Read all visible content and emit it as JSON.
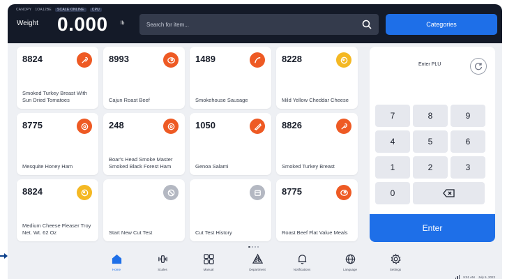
{
  "header": {
    "tiny_tags": [
      "CANOPY",
      "1OA12BE",
      "SCALE ONLINE",
      "CPU"
    ],
    "weight_label": "Weight",
    "weight_value": "0.000",
    "weight_unit": "lb",
    "search_placeholder": "Search for item...",
    "categories_label": "Categories"
  },
  "products": [
    {
      "plu": "8824",
      "name": "Smoked Turkey Breast With Sun Dried Tomatoes",
      "icon": "turkey-icon",
      "color": "#ee5a24"
    },
    {
      "plu": "8993",
      "name": "Cajun Roast Beef",
      "icon": "beef-icon",
      "color": "#ee5a24"
    },
    {
      "plu": "1489",
      "name": "Smokehouse Sausage",
      "icon": "sausage-icon",
      "color": "#ee5a24"
    },
    {
      "plu": "8228",
      "name": "Mild Yellow Cheddar Cheese",
      "icon": "cheese-icon",
      "color": "#f4b823"
    },
    {
      "plu": "8775",
      "name": "Mesquite Honey Ham",
      "icon": "ham-icon",
      "color": "#ee5a24"
    },
    {
      "plu": "248",
      "name": "Boar's Head Smoke Master Smoked Black Forest Ham",
      "icon": "ham-icon",
      "color": "#ee5a24"
    },
    {
      "plu": "1050",
      "name": "Genoa Salami",
      "icon": "salami-icon",
      "color": "#ee5a24"
    },
    {
      "plu": "8826",
      "name": "Smoked Turkey Breast",
      "icon": "turkey-icon",
      "color": "#ee5a24"
    },
    {
      "plu": "8824",
      "name": "Medium Cheese Fleaser Troy Net. Wt. 62 Oz",
      "icon": "cheese-icon",
      "color": "#f4b823"
    },
    {
      "plu": "",
      "name": "Start New Cut Test",
      "icon": "ban-icon",
      "color": "#b4b8c2"
    },
    {
      "plu": "",
      "name": "Cut Test History",
      "icon": "calendar-icon",
      "color": "#b4b8c2"
    },
    {
      "plu": "8775",
      "name": "Roast Beef Flat Value Meals",
      "icon": "beef-icon",
      "color": "#ee5a24"
    }
  ],
  "keypad": {
    "title": "Enter PLU",
    "keys": [
      "7",
      "8",
      "9",
      "4",
      "5",
      "6",
      "1",
      "2",
      "3",
      "0"
    ],
    "enter_label": "Enter"
  },
  "nav": [
    {
      "label": "Home",
      "icon": "home-icon",
      "active": true
    },
    {
      "label": "Scales",
      "icon": "scale-icon",
      "active": false
    },
    {
      "label": "Manual",
      "icon": "grid-icon",
      "active": false
    },
    {
      "label": "Department",
      "icon": "department-icon",
      "active": false
    },
    {
      "label": "Notifications",
      "icon": "bell-icon",
      "active": false
    },
    {
      "label": "Language",
      "icon": "globe-icon",
      "active": false
    },
    {
      "label": "Settings",
      "icon": "gear-icon",
      "active": false
    }
  ],
  "status": {
    "time": "9:51 AM",
    "date": "July 5, 2023"
  },
  "colors": {
    "accent": "#1e6fe8",
    "topbar": "#141a28",
    "orange": "#ee5a24",
    "yellow": "#f4b823"
  }
}
